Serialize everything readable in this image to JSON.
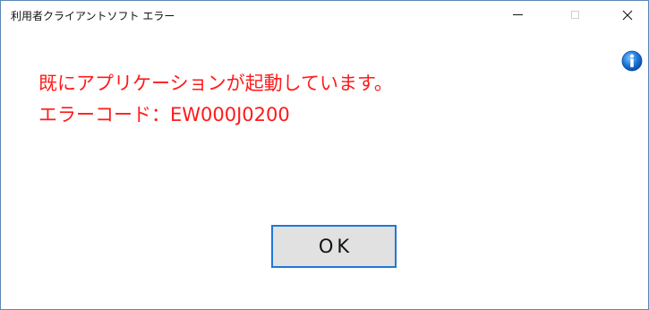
{
  "window": {
    "title": "利用者クライアントソフト エラー"
  },
  "controls": {
    "minimize_icon": "minimize-icon",
    "maximize_icon": "maximize-icon",
    "close_icon": "close-icon"
  },
  "dialog": {
    "icon": "info-icon",
    "message_line1": "既にアプリケーションが起動しています。",
    "message_line2": "エラーコード：EW000J0200",
    "message_color": "#ff1a1a",
    "ok_label": "OK"
  },
  "colors": {
    "window_border": "#5a86b8",
    "button_focus_border": "#1e78d7",
    "button_background": "#e1e1e1"
  }
}
